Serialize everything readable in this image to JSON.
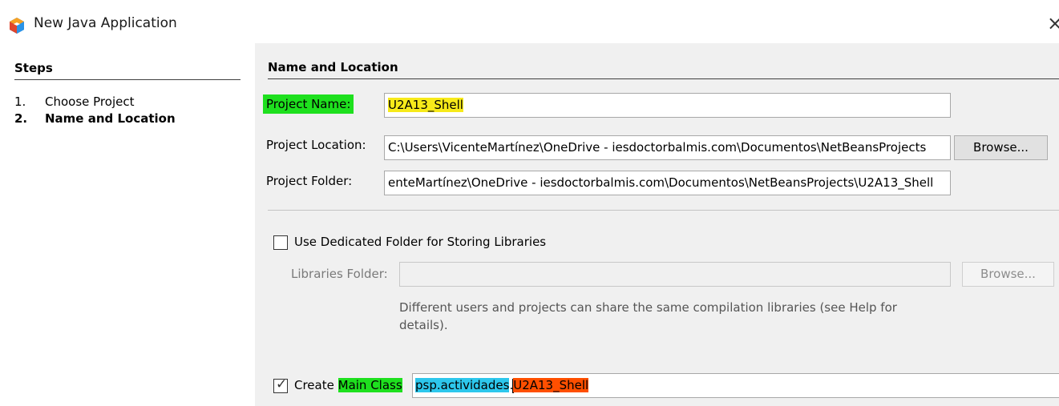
{
  "window": {
    "title": "New Java Application",
    "close_icon": "close-icon"
  },
  "steps": {
    "header": "Steps",
    "items": [
      {
        "number": "1.",
        "label": "Choose Project"
      },
      {
        "number": "2.",
        "label": "Name and Location"
      }
    ]
  },
  "form": {
    "section_title": "Name and Location",
    "project_name_label": "Project Name:",
    "project_name_value": "U2A13_Shell",
    "project_location_label": "Project Location:",
    "project_location_value": "C:\\Users\\VicenteMartínez\\OneDrive - iesdoctorbalmis.com\\Documentos\\NetBeansProjects",
    "browse_label": "Browse...",
    "project_folder_label": "Project Folder:",
    "project_folder_value": "enteMartínez\\OneDrive - iesdoctorbalmis.com\\Documentos\\NetBeansProjects\\U2A13_Shell",
    "dedicated_folder_label": "Use Dedicated Folder for Storing Libraries",
    "dedicated_folder_checked": false,
    "libraries_folder_label": "Libraries Folder:",
    "libraries_folder_value": "",
    "libraries_browse_label": "Browse...",
    "libraries_help_text": "Different users and projects can share the same compilation libraries (see Help for details).",
    "create_label": "Create",
    "main_class_label": "Main Class",
    "main_class_checked": true,
    "main_class_package": "psp.actividades",
    "main_class_dot": ".",
    "main_class_name": "U2A13_Shell"
  },
  "colors": {
    "highlight_green": "#1ee01e",
    "highlight_yellow": "#f7ea1a",
    "highlight_cyan": "#2dc7ec",
    "highlight_orange": "#ff4f00"
  }
}
